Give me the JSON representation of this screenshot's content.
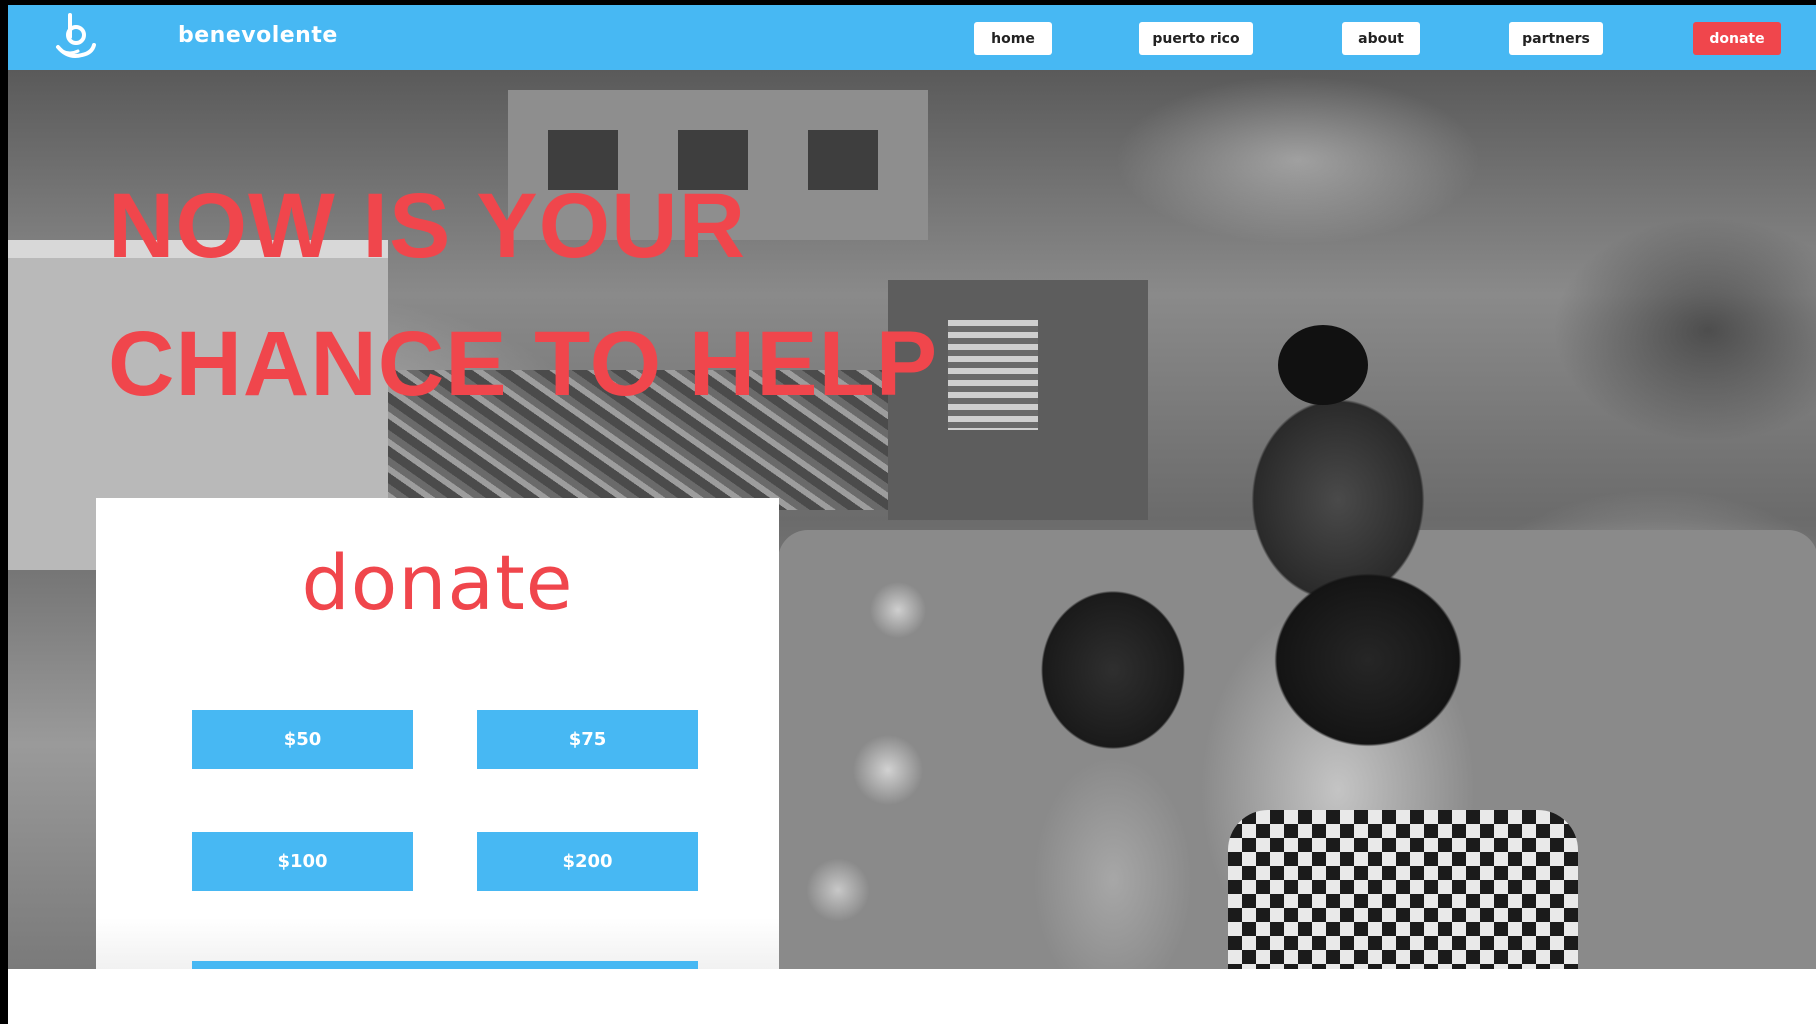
{
  "brand": {
    "name": "benevolente",
    "logo_icon": "hand-holding-b-logo",
    "color": "#47b8f3"
  },
  "nav": {
    "items": [
      {
        "label": "home"
      },
      {
        "label": "puerto rico"
      },
      {
        "label": "about"
      },
      {
        "label": "partners"
      },
      {
        "label": "donate",
        "accent": "#f0464c"
      }
    ]
  },
  "hero": {
    "headline_line1": "NOW IS YOUR",
    "headline_line2": "CHANCE TO HELP",
    "headline_color": "#f0464c",
    "image": "black-and-white photo of a mother holding two children in front of hurricane debris"
  },
  "donate_card": {
    "title": "donate",
    "amounts": [
      "$50",
      "$75",
      "$100",
      "$200"
    ],
    "button_color": "#47b8f3"
  }
}
